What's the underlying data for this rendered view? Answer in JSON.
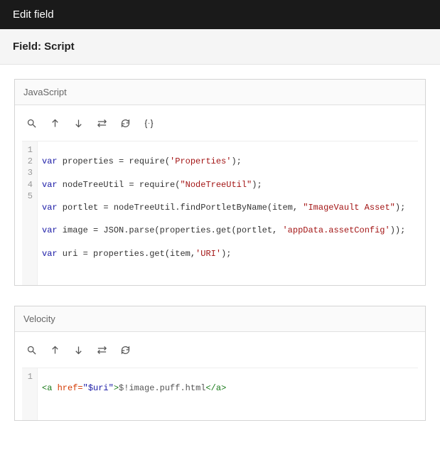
{
  "header": {
    "title": "Edit field"
  },
  "subheader": {
    "title": "Field: Script"
  },
  "panels": {
    "js": {
      "title": "JavaScript",
      "toolbar": {
        "search": "⌕",
        "up": "↑",
        "down": "↓",
        "swap": "⇄",
        "refresh": "⟳",
        "indent": "{·}"
      },
      "lines": [
        "1",
        "2",
        "3",
        "4",
        "5"
      ],
      "code": {
        "l1": {
          "kw": "var",
          "v": " properties = require(",
          "s": "'Properties'",
          "e": ");"
        },
        "l2": {
          "kw": "var",
          "v": " nodeTreeUtil = require(",
          "s": "\"NodeTreeUtil\"",
          "e": ");"
        },
        "l3": {
          "kw": "var",
          "v": " portlet = nodeTreeUtil.findPortletByName(item, ",
          "s": "\"ImageVault Asset\"",
          "e": ");"
        },
        "l4": {
          "kw": "var",
          "v": " image = JSON.parse(properties.get(portlet, ",
          "s": "'appData.assetConfig'",
          "e": "));"
        },
        "l5": {
          "kw": "var",
          "v": " uri = properties.get(item,",
          "s": "'URI'",
          "e": ");"
        }
      }
    },
    "vel": {
      "title": "Velocity",
      "toolbar": {
        "search": "⌕",
        "up": "↑",
        "down": "↓",
        "swap": "⇄",
        "refresh": "⟳"
      },
      "lines": [
        "1"
      ],
      "code": {
        "l1": {
          "open": "<a ",
          "attr": "href=",
          "val": "\"$uri\"",
          "gt": ">",
          "body": "$!image.puff.html",
          "close": "</a>"
        }
      }
    }
  }
}
